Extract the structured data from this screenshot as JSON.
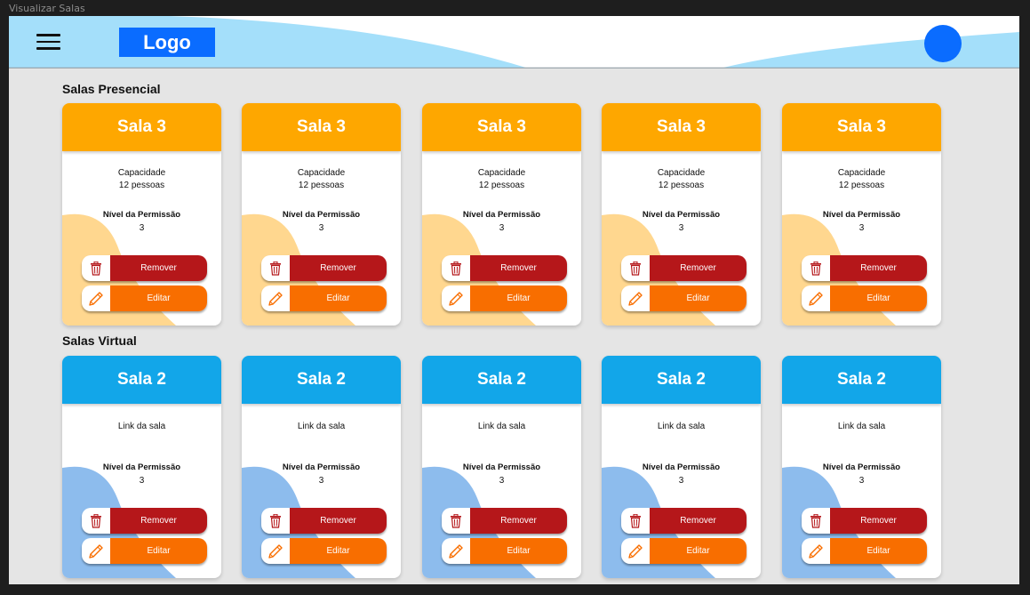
{
  "window": {
    "title": "Visualizar Salas"
  },
  "header": {
    "logo": "Logo",
    "menu_icon": "hamburger-menu-icon",
    "avatar_icon": "user-avatar"
  },
  "colors": {
    "presencial_head": "#fea700",
    "presencial_blob": "#ffd78f",
    "virtual_head": "#12a6e9",
    "virtual_blob": "#8dbced",
    "remove": "#b5171a",
    "edit": "#f86e00",
    "header_wave": "#a4dffa"
  },
  "sections": [
    {
      "title": "Salas Presencial",
      "rooms": [
        {
          "name": "Sala 3",
          "capacity_label": "Capacidade",
          "capacity_value": "12 pessoas",
          "permission_label": "Nível da Permissão",
          "permission_value": "3",
          "remove_label": "Remover",
          "edit_label": "Editar"
        },
        {
          "name": "Sala 3",
          "capacity_label": "Capacidade",
          "capacity_value": "12 pessoas",
          "permission_label": "Nível da Permissão",
          "permission_value": "3",
          "remove_label": "Remover",
          "edit_label": "Editar"
        },
        {
          "name": "Sala 3",
          "capacity_label": "Capacidade",
          "capacity_value": "12 pessoas",
          "permission_label": "Nível da Permissão",
          "permission_value": "3",
          "remove_label": "Remover",
          "edit_label": "Editar"
        },
        {
          "name": "Sala 3",
          "capacity_label": "Capacidade",
          "capacity_value": "12 pessoas",
          "permission_label": "Nível da Permissão",
          "permission_value": "3",
          "remove_label": "Remover",
          "edit_label": "Editar"
        },
        {
          "name": "Sala 3",
          "capacity_label": "Capacidade",
          "capacity_value": "12 pessoas",
          "permission_label": "Nível da Permissão",
          "permission_value": "3",
          "remove_label": "Remover",
          "edit_label": "Editar"
        }
      ]
    },
    {
      "title": "Salas Virtual",
      "rooms": [
        {
          "name": "Sala 2",
          "link_label": "Link da sala",
          "permission_label": "Nível da Permissão",
          "permission_value": "3",
          "remove_label": "Remover",
          "edit_label": "Editar"
        },
        {
          "name": "Sala 2",
          "link_label": "Link da sala",
          "permission_label": "Nível da Permissão",
          "permission_value": "3",
          "remove_label": "Remover",
          "edit_label": "Editar"
        },
        {
          "name": "Sala 2",
          "link_label": "Link da sala",
          "permission_label": "Nível da Permissão",
          "permission_value": "3",
          "remove_label": "Remover",
          "edit_label": "Editar"
        },
        {
          "name": "Sala 2",
          "link_label": "Link da sala",
          "permission_label": "Nível da Permissão",
          "permission_value": "3",
          "remove_label": "Remover",
          "edit_label": "Editar"
        },
        {
          "name": "Sala 2",
          "link_label": "Link da sala",
          "permission_label": "Nível da Permissão",
          "permission_value": "3",
          "remove_label": "Remover",
          "edit_label": "Editar"
        }
      ]
    }
  ]
}
